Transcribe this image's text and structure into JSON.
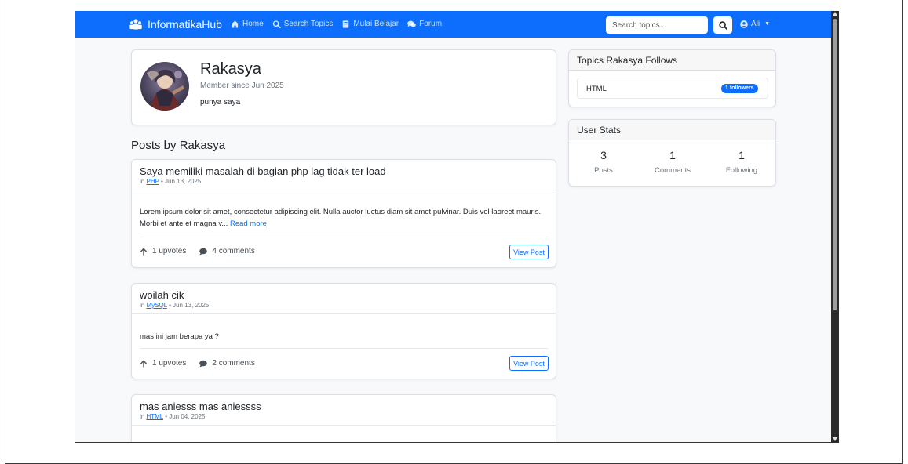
{
  "navbar": {
    "brand": "InformatikaHub",
    "links": [
      "Home",
      "Search Topics",
      "Mulai Belajar",
      "Forum"
    ],
    "search_placeholder": "Search topics...",
    "user": "Ali"
  },
  "profile": {
    "name": "Rakasya",
    "member_since": "Member since Jun 2025",
    "bio": "punya saya"
  },
  "posts_section_title": "Posts by Rakasya",
  "posts": [
    {
      "title": "Saya memiliki masalah di bagian php lag tidak ter load",
      "meta_prefix": "in",
      "topic": "PHP",
      "date": "• Jun 13, 2025",
      "excerpt": "Lorem ipsum dolor sit amet, consectetur adipiscing elit. Nulla auctor luctus diam sit amet pulvinar. Duis vel laoreet mauris. Morbi et ante et magna v...",
      "read_more": "Read more",
      "upvotes": "1 upvotes",
      "comments": "4 comments",
      "view_label": "View Post"
    },
    {
      "title": "woilah cik",
      "meta_prefix": "in",
      "topic": "MySQL",
      "date": "• Jun 13, 2025",
      "excerpt": "mas ini jam berapa ya ?",
      "upvotes": "1 upvotes",
      "comments": "2 comments",
      "view_label": "View Post"
    },
    {
      "title": "mas aniesss mas aniessss",
      "meta_prefix": "in",
      "topic": "HTML",
      "date": "• Jun 04, 2025"
    }
  ],
  "follows": {
    "title": "Topics Rakasya Follows",
    "items": [
      {
        "name": "HTML",
        "badge": "1 followers"
      }
    ]
  },
  "stats": {
    "title": "User Stats",
    "items": [
      {
        "value": "3",
        "label": "Posts"
      },
      {
        "value": "1",
        "label": "Comments"
      },
      {
        "value": "1",
        "label": "Following"
      }
    ]
  },
  "colors": {
    "primary": "#0d6efd",
    "background": "#f8f9fa"
  }
}
